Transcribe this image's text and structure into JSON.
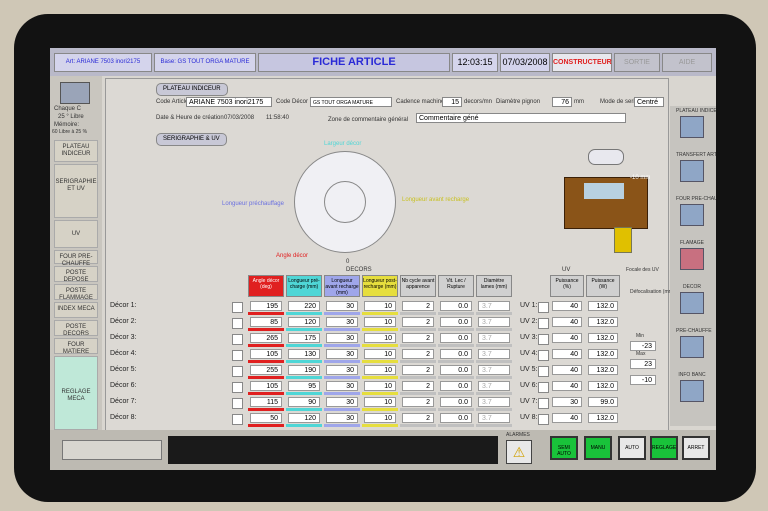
{
  "topbar": {
    "article_code": "Art: ARIANE 7503 inori2175",
    "base_label": "Base: GS TOUT ORGA MATURE",
    "title": "FICHE ARTICLE",
    "time": "12:03:15",
    "date": "07/03/2008",
    "constructeur": "CONSTRUCTEUR",
    "sortie": "SORTIE",
    "aide": "AIDE"
  },
  "left": {
    "user_name": "Chaque C",
    "temp": "25 ° Libre",
    "memoire": "Mémoire:",
    "memoire_value": "60 Libre à 25 %",
    "nav": [
      "PLATEAU INDICEUR",
      "SERIGRAPHIE ET UV",
      "UV",
      "FOUR PRE-CHAUFFE",
      "POSTE DEPOSE",
      "POSTE FLAMMAGE",
      "INDEX MECA",
      "POSTE DECORS",
      "FOUR MATIERE",
      "REGLAGE MECA"
    ]
  },
  "platform": {
    "section": "PLATEAU INDICEUR",
    "code_article_label": "Code Article",
    "code_article_value": "ARIANE 7503 inori2175",
    "code_decor_label": "Code Décor",
    "code_decor_value": "GS TOUT ORGA MATURE",
    "cadence_label": "Cadence machine",
    "cadence_value": "15",
    "cadence_unit": "decors/mn",
    "diametre_label": "Diamètre pignon",
    "diametre_value": "76",
    "diametre_unit": "mm",
    "mode_label": "Mode de serigraphie",
    "mode_value": "Centré",
    "date_label": "Date & Heure de création",
    "date_value": "07/03/2008",
    "time_value": "11:58:40",
    "comment_label": "Zone de commentaire général",
    "comment_value": "Commentaire géné"
  },
  "serigraphie": {
    "section": "SERIGRAPHIE & UV",
    "largeur_decor": "Largeur décor",
    "longueur_prechauffage": "Longueur préchauffage",
    "longueur_avant_recharge": "Longueur avant recharge",
    "angle_decor": "Angle décor",
    "dim_label": "-10 mm",
    "zero_label": "0"
  },
  "decors": {
    "group_title": "DECORS",
    "uv_title": "UV",
    "focale_title": "Focale des UV",
    "focale_sub": "Défocalisation (mm)",
    "col_headers": [
      "Angle décor (deg)",
      "Longueur pré-charge (mm)",
      "Longueur avant recharge (mm)",
      "Longueur post-recharge (mm)",
      "Nb cycle avant apparence",
      "Vit. Lec / Rupture",
      "Diamètre lames (mm)"
    ],
    "uv_headers": [
      "Puissance (%)",
      "Puissance (W)"
    ],
    "rows": [
      {
        "label": "Décor 1:",
        "v1": "195",
        "v2": "220",
        "v3": "30",
        "v4": "10",
        "v5": "2",
        "v6": "0.0",
        "v7": "3.7",
        "uv_label": "UV 1:",
        "p1": "40",
        "p2": "132.0"
      },
      {
        "label": "Décor 2:",
        "v1": "85",
        "v2": "120",
        "v3": "30",
        "v4": "10",
        "v5": "2",
        "v6": "0.0",
        "v7": "3.7",
        "uv_label": "UV 2:",
        "p1": "40",
        "p2": "132.0"
      },
      {
        "label": "Décor 3:",
        "v1": "265",
        "v2": "175",
        "v3": "30",
        "v4": "10",
        "v5": "2",
        "v6": "0.0",
        "v7": "3.7",
        "uv_label": "UV 3:",
        "p1": "40",
        "p2": "132.0"
      },
      {
        "label": "Décor 4:",
        "v1": "105",
        "v2": "130",
        "v3": "30",
        "v4": "10",
        "v5": "2",
        "v6": "0.0",
        "v7": "3.7",
        "uv_label": "UV 4:",
        "p1": "40",
        "p2": "132.0"
      },
      {
        "label": "Décor 5:",
        "v1": "255",
        "v2": "190",
        "v3": "30",
        "v4": "10",
        "v5": "2",
        "v6": "0.0",
        "v7": "3.7",
        "uv_label": "UV 5:",
        "p1": "40",
        "p2": "132.0"
      },
      {
        "label": "Décor 6:",
        "v1": "105",
        "v2": "95",
        "v3": "30",
        "v4": "10",
        "v5": "2",
        "v6": "0.0",
        "v7": "3.7",
        "uv_label": "UV 6:",
        "p1": "40",
        "p2": "132.0"
      },
      {
        "label": "Décor 7:",
        "v1": "115",
        "v2": "90",
        "v3": "30",
        "v4": "10",
        "v5": "2",
        "v6": "0.0",
        "v7": "3.7",
        "uv_label": "UV 7:",
        "p1": "30",
        "p2": "99.0"
      },
      {
        "label": "Décor 8:",
        "v1": "50",
        "v2": "120",
        "v3": "30",
        "v4": "10",
        "v5": "2",
        "v6": "0.0",
        "v7": "3.7",
        "uv_label": "UV 8:",
        "p1": "40",
        "p2": "132.0"
      }
    ],
    "focale": {
      "v1": "-23",
      "v2": "23",
      "v3": "-10",
      "lbl1": "Min",
      "lbl2": "Max"
    }
  },
  "right": {
    "items": [
      "PLATEAU INDICEUR",
      "TRANSFERT ART.",
      "FOUR PRE-CHAUFFE",
      "FLAMAGE",
      "DECOR",
      "PRE-CHAUFFE",
      "INFO BANC"
    ]
  },
  "bottom": {
    "alarmes": "ALARMES",
    "buttons": [
      "SEMI AUTO",
      "MANU",
      "AUTO",
      "REGLAGE",
      "ARRET"
    ]
  },
  "colors": {
    "red": "#e02020",
    "cyan": "#4fd6d6",
    "blue": "#9fa6ea",
    "yellow": "#e6de3e",
    "green": "#19c23a",
    "title": "#2a2ad6"
  }
}
